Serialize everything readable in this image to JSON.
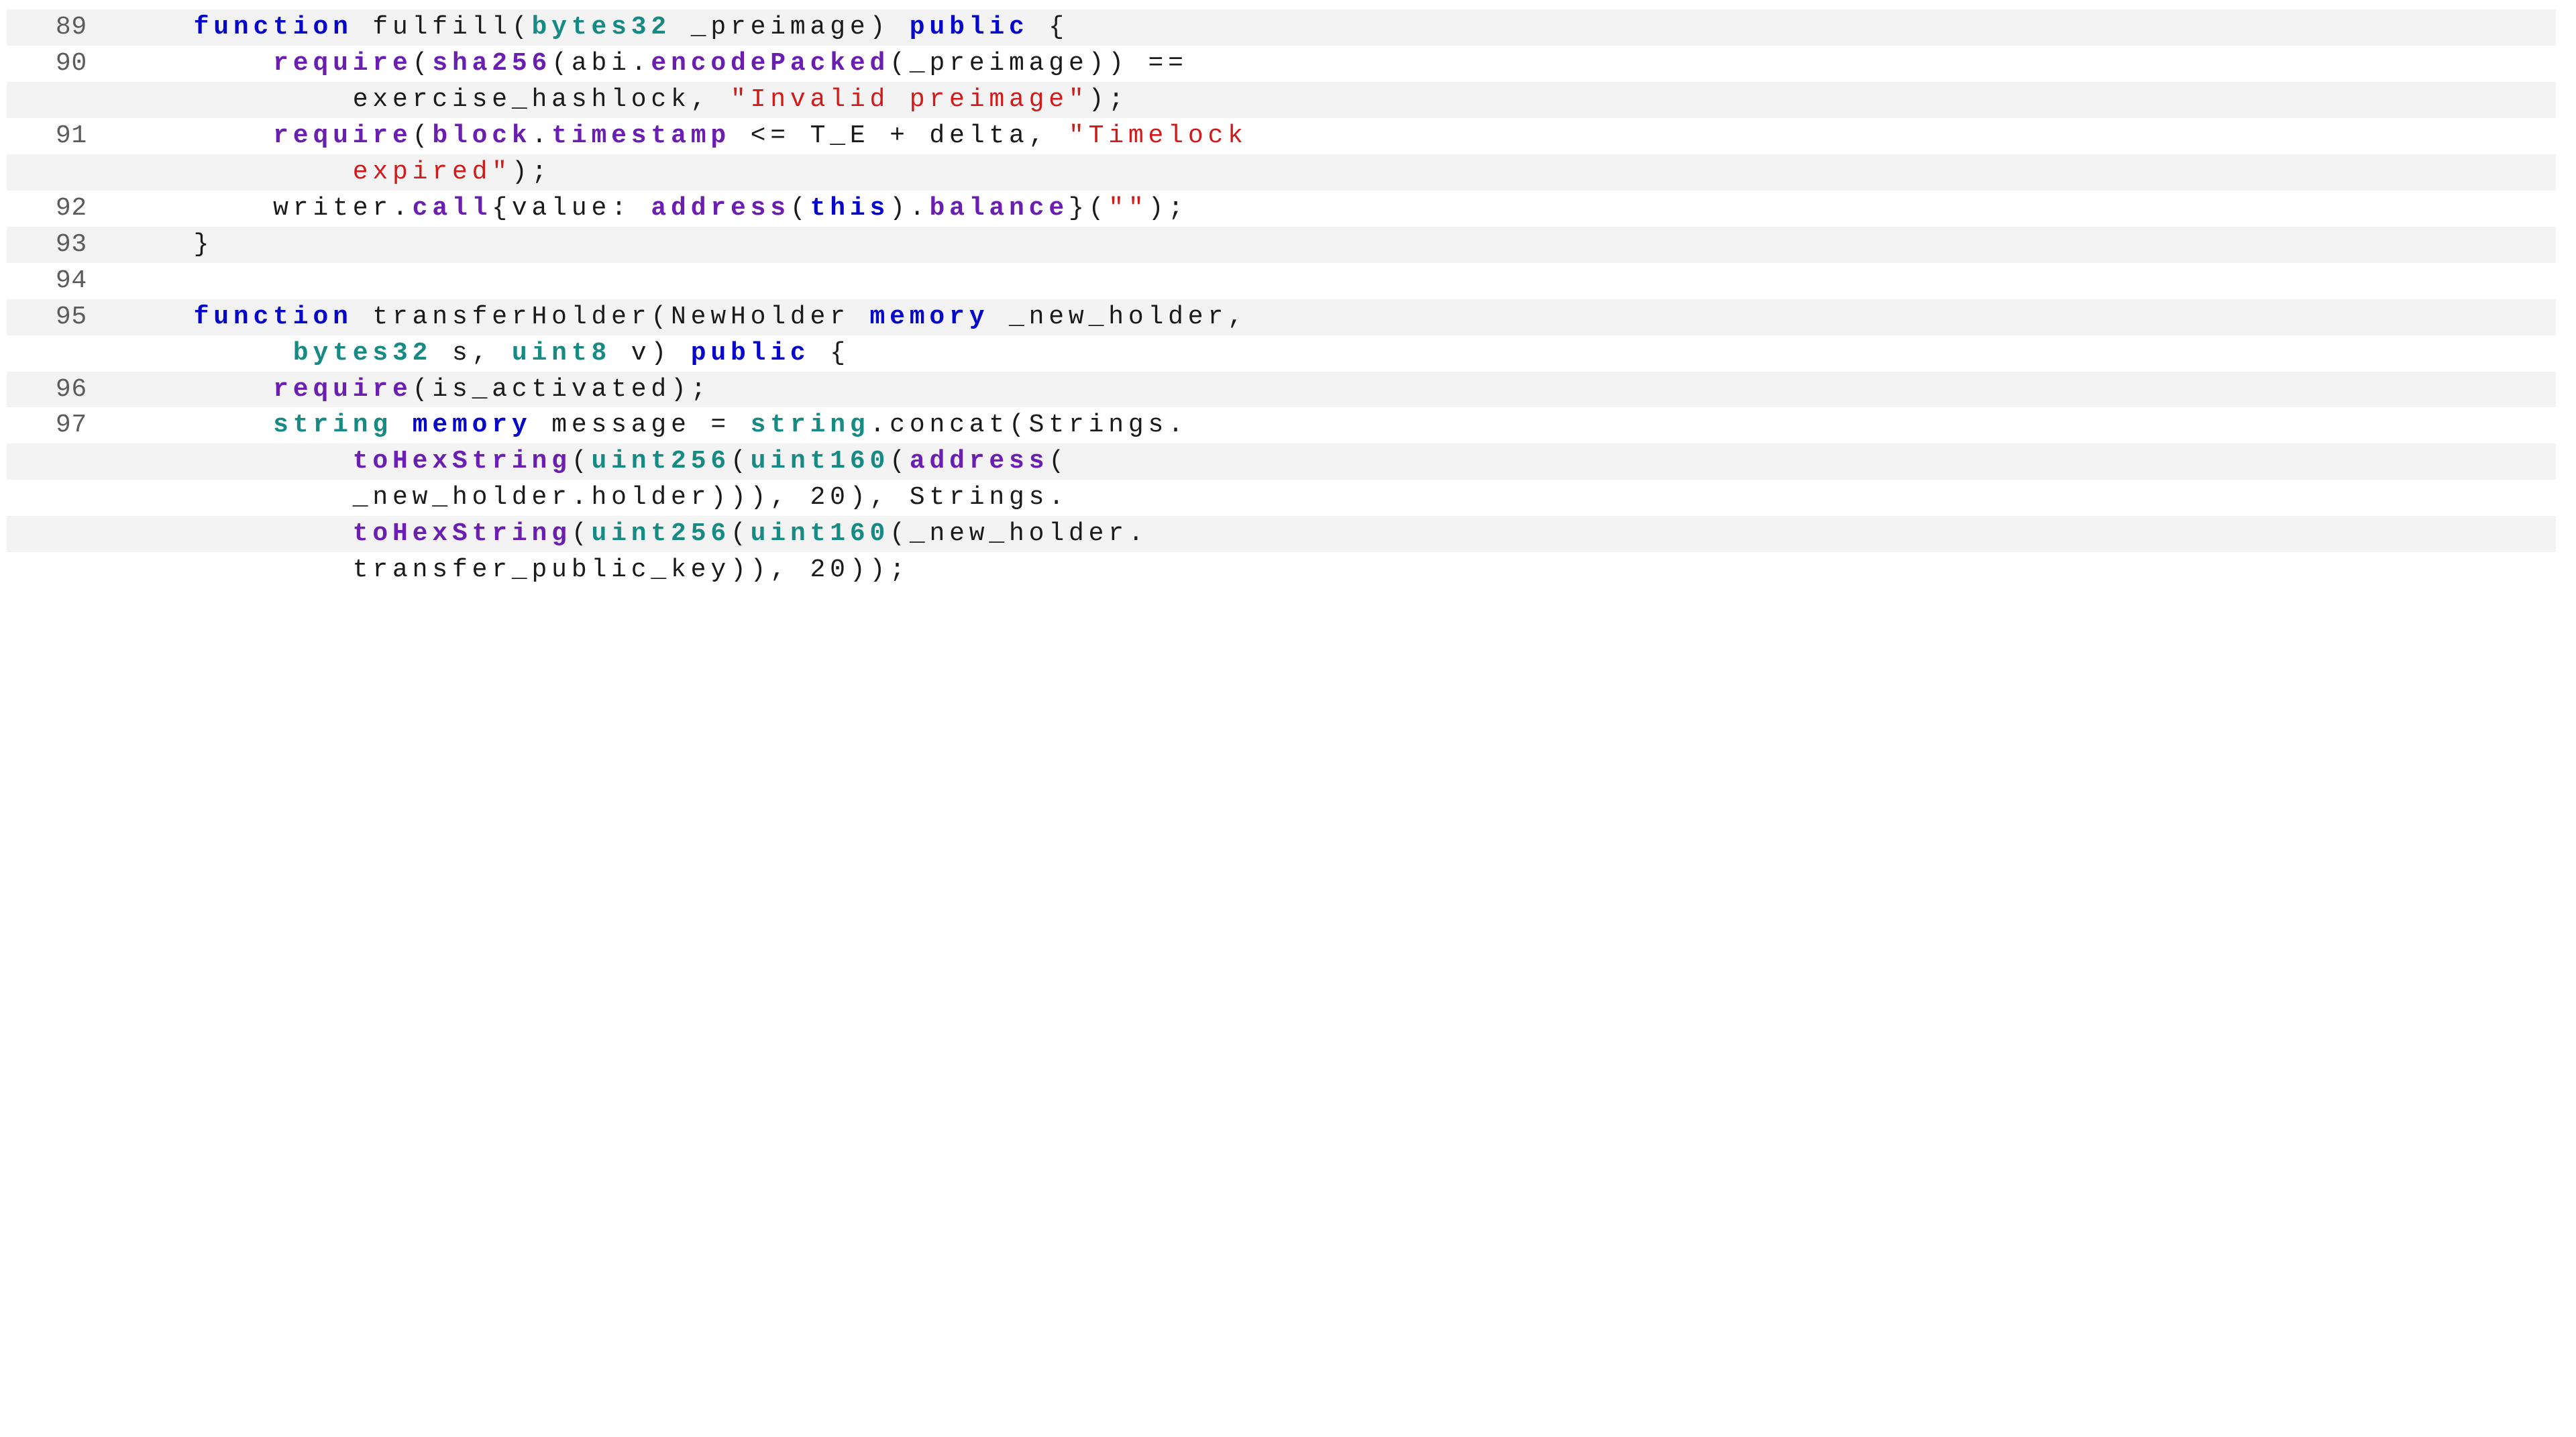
{
  "lines": [
    {
      "num": "89",
      "shade": true,
      "indent": "    ",
      "tokens": [
        {
          "cls": "kw",
          "t": "function"
        },
        {
          "t": " fulfill("
        },
        {
          "cls": "type",
          "t": "bytes32"
        },
        {
          "t": " _preimage) "
        },
        {
          "cls": "kw",
          "t": "public"
        },
        {
          "t": " {"
        }
      ]
    },
    {
      "num": "90",
      "shade": false,
      "indent": "        ",
      "tokens": [
        {
          "cls": "fn",
          "t": "require"
        },
        {
          "t": "("
        },
        {
          "cls": "fn",
          "t": "sha256"
        },
        {
          "t": "(abi."
        },
        {
          "cls": "fn",
          "t": "encodePacked"
        },
        {
          "t": "(_preimage)) =="
        }
      ]
    },
    {
      "num": "",
      "shade": true,
      "indent": "            ",
      "tokens": [
        {
          "t": "exercise_hashlock, "
        },
        {
          "cls": "str",
          "t": "\"Invalid preimage\""
        },
        {
          "t": ");"
        }
      ]
    },
    {
      "num": "91",
      "shade": false,
      "indent": "        ",
      "tokens": [
        {
          "cls": "fn",
          "t": "require"
        },
        {
          "t": "("
        },
        {
          "cls": "fn",
          "t": "block"
        },
        {
          "t": "."
        },
        {
          "cls": "fn",
          "t": "timestamp"
        },
        {
          "t": " <= T_E + delta, "
        },
        {
          "cls": "str",
          "t": "\"Timelock"
        }
      ]
    },
    {
      "num": "",
      "shade": true,
      "indent": "            ",
      "tokens": [
        {
          "cls": "str",
          "t": "expired\""
        },
        {
          "t": ");"
        }
      ]
    },
    {
      "num": "92",
      "shade": false,
      "indent": "        ",
      "tokens": [
        {
          "t": "writer."
        },
        {
          "cls": "fn",
          "t": "call"
        },
        {
          "t": "{value: "
        },
        {
          "cls": "fn",
          "t": "address"
        },
        {
          "t": "("
        },
        {
          "cls": "kw",
          "t": "this"
        },
        {
          "t": ")."
        },
        {
          "cls": "fn",
          "t": "balance"
        },
        {
          "t": "}("
        },
        {
          "cls": "str",
          "t": "\"\""
        },
        {
          "t": ");"
        }
      ]
    },
    {
      "num": "93",
      "shade": true,
      "indent": "    ",
      "tokens": [
        {
          "t": "}"
        }
      ]
    },
    {
      "num": "94",
      "shade": false,
      "indent": "",
      "tokens": [
        {
          "t": ""
        }
      ]
    },
    {
      "num": "95",
      "shade": true,
      "indent": "    ",
      "tokens": [
        {
          "cls": "kw",
          "t": "function"
        },
        {
          "t": " transferHolder(NewHolder "
        },
        {
          "cls": "kw",
          "t": "memory"
        },
        {
          "t": " _new_holder,"
        }
      ]
    },
    {
      "num": "",
      "shade": false,
      "indent": "         ",
      "tokens": [
        {
          "cls": "type",
          "t": "bytes32"
        },
        {
          "t": " s, "
        },
        {
          "cls": "type",
          "t": "uint8"
        },
        {
          "t": " v) "
        },
        {
          "cls": "kw",
          "t": "public"
        },
        {
          "t": " {"
        }
      ]
    },
    {
      "num": "96",
      "shade": true,
      "indent": "        ",
      "tokens": [
        {
          "cls": "fn",
          "t": "require"
        },
        {
          "t": "(is_activated);"
        }
      ]
    },
    {
      "num": "97",
      "shade": false,
      "indent": "        ",
      "tokens": [
        {
          "cls": "type",
          "t": "string"
        },
        {
          "t": " "
        },
        {
          "cls": "kw",
          "t": "memory"
        },
        {
          "t": " message = "
        },
        {
          "cls": "type",
          "t": "string"
        },
        {
          "t": ".concat(Strings."
        }
      ]
    },
    {
      "num": "",
      "shade": true,
      "indent": "            ",
      "tokens": [
        {
          "cls": "fn",
          "t": "toHexString"
        },
        {
          "t": "("
        },
        {
          "cls": "type",
          "t": "uint256"
        },
        {
          "t": "("
        },
        {
          "cls": "type",
          "t": "uint160"
        },
        {
          "t": "("
        },
        {
          "cls": "fn",
          "t": "address"
        },
        {
          "t": "("
        }
      ]
    },
    {
      "num": "",
      "shade": false,
      "indent": "            ",
      "tokens": [
        {
          "t": "_new_holder.holder))), 20), Strings."
        }
      ]
    },
    {
      "num": "",
      "shade": true,
      "indent": "            ",
      "tokens": [
        {
          "cls": "fn",
          "t": "toHexString"
        },
        {
          "t": "("
        },
        {
          "cls": "type",
          "t": "uint256"
        },
        {
          "t": "("
        },
        {
          "cls": "type",
          "t": "uint160"
        },
        {
          "t": "(_new_holder."
        }
      ]
    },
    {
      "num": "",
      "shade": false,
      "indent": "            ",
      "tokens": [
        {
          "t": "transfer_public_key)), 20));"
        }
      ]
    }
  ]
}
